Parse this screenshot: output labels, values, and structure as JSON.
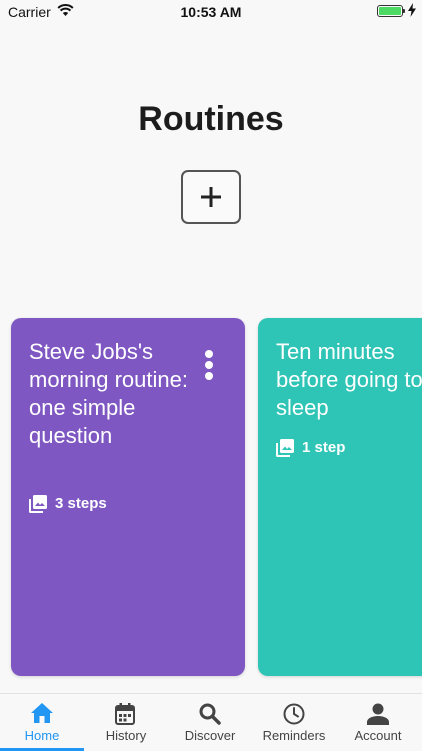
{
  "status_bar": {
    "carrier": "Carrier",
    "time": "10:53 AM"
  },
  "page": {
    "title": "Routines"
  },
  "routines": [
    {
      "title": "Steve Jobs's morning routine: one simple question",
      "steps": "3 steps",
      "color": "#7e57c2"
    },
    {
      "title": "Ten minutes before going to sleep",
      "steps": "1 step",
      "color": "#2ec4b6"
    }
  ],
  "tabs": [
    {
      "label": "Home",
      "icon": "home-icon",
      "active": true
    },
    {
      "label": "History",
      "icon": "calendar-icon"
    },
    {
      "label": "Discover",
      "icon": "search-icon"
    },
    {
      "label": "Reminders",
      "icon": "clock-icon"
    },
    {
      "label": "Account",
      "icon": "person-icon"
    }
  ],
  "colors": {
    "accent": "#2196f3",
    "background": "#f8f8f8"
  }
}
